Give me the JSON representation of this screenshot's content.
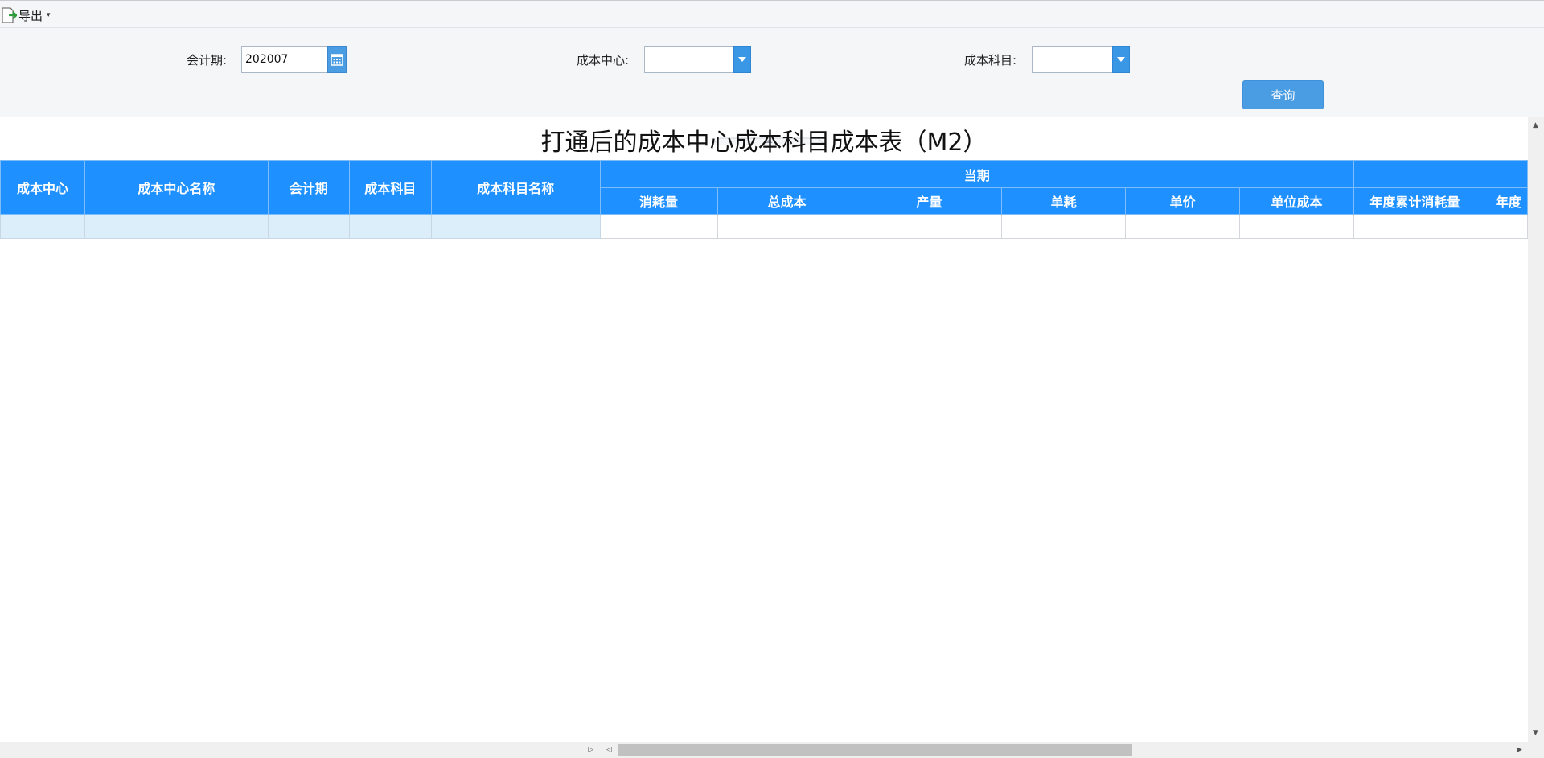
{
  "toolbar": {
    "export_label": "导出",
    "export_caret": "▾"
  },
  "filters": {
    "period_label": "会计期:",
    "period_value": "202007",
    "cost_center_label": "成本中心:",
    "cost_center_value": "",
    "cost_item_label": "成本科目:",
    "cost_item_value": "",
    "query_label": "查询"
  },
  "report": {
    "title": "打通后的成本中心成本科目成本表（M2）"
  },
  "table": {
    "frozen_columns": [
      "成本中心",
      "成本中心名称",
      "会计期",
      "成本科目",
      "成本科目名称"
    ],
    "group_header": "当期",
    "group_columns": [
      "消耗量",
      "总成本",
      "产量",
      "单耗",
      "单价",
      "单位成本"
    ],
    "extra_columns": [
      "年度累计消耗量",
      "年度"
    ]
  },
  "scroll": {
    "left": "◀",
    "right": "▶",
    "up": "▲",
    "down": "▼",
    "split_left": "◁",
    "split_right": "▷"
  },
  "colors": {
    "header": "#1e90ff",
    "button": "#4a9ce3",
    "frozen_cell": "#ddeefb"
  }
}
